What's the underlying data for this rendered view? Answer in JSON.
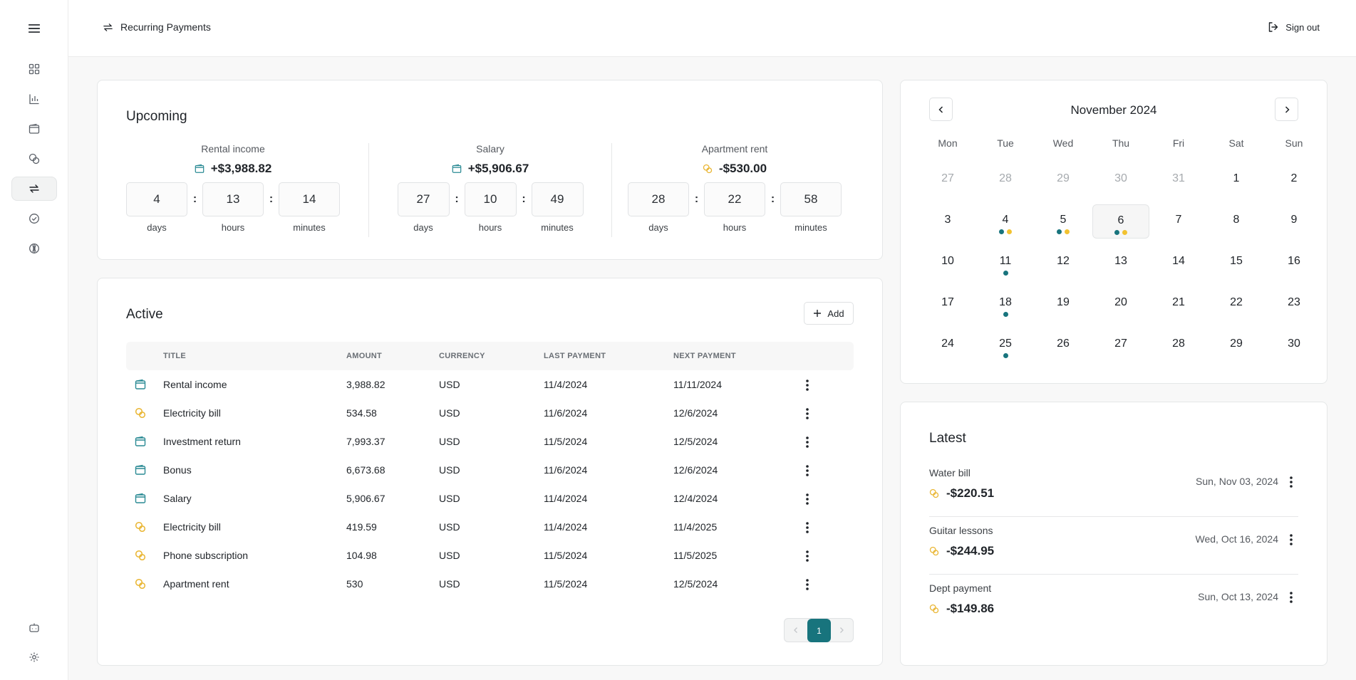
{
  "header": {
    "title": "Recurring Payments",
    "signout_label": "Sign out"
  },
  "sidebar": {
    "items": [
      {
        "icon": "menu-icon"
      },
      {
        "icon": "dashboard-icon"
      },
      {
        "icon": "chart-icon"
      },
      {
        "icon": "wallet-icon"
      },
      {
        "icon": "coins-icon"
      },
      {
        "icon": "recurring-icon",
        "active": true
      },
      {
        "icon": "check-circle-icon"
      },
      {
        "icon": "globe-icon"
      },
      {
        "icon": "bot-icon"
      },
      {
        "icon": "gear-icon"
      }
    ]
  },
  "upcoming": {
    "title": "Upcoming",
    "unit_labels": {
      "days": "days",
      "hours": "hours",
      "minutes": "minutes"
    },
    "items": [
      {
        "label": "Rental income",
        "amount": "+$3,988.82",
        "icon": "wallet-icon",
        "days": "4",
        "hours": "13",
        "minutes": "14"
      },
      {
        "label": "Salary",
        "amount": "+$5,906.67",
        "icon": "wallet-icon",
        "days": "27",
        "hours": "10",
        "minutes": "49"
      },
      {
        "label": "Apartment rent",
        "amount": "-$530.00",
        "icon": "coins-icon",
        "days": "28",
        "hours": "22",
        "minutes": "58"
      }
    ]
  },
  "active": {
    "title": "Active",
    "add_label": "Add",
    "columns": {
      "title": "TITLE",
      "amount": "AMOUNT",
      "currency": "CURRENCY",
      "last_payment": "LAST PAYMENT",
      "next_payment": "NEXT PAYMENT"
    },
    "rows": [
      {
        "icon": "wallet-icon",
        "title": "Rental income",
        "amount": "3,988.82",
        "currency": "USD",
        "last": "11/4/2024",
        "next": "11/11/2024"
      },
      {
        "icon": "coins-icon",
        "title": "Electricity bill",
        "amount": "534.58",
        "currency": "USD",
        "last": "11/6/2024",
        "next": "12/6/2024"
      },
      {
        "icon": "wallet-icon",
        "title": "Investment return",
        "amount": "7,993.37",
        "currency": "USD",
        "last": "11/5/2024",
        "next": "12/5/2024"
      },
      {
        "icon": "wallet-icon",
        "title": "Bonus",
        "amount": "6,673.68",
        "currency": "USD",
        "last": "11/6/2024",
        "next": "12/6/2024"
      },
      {
        "icon": "wallet-icon",
        "title": "Salary",
        "amount": "5,906.67",
        "currency": "USD",
        "last": "11/4/2024",
        "next": "12/4/2024"
      },
      {
        "icon": "coins-icon",
        "title": "Electricity bill",
        "amount": "419.59",
        "currency": "USD",
        "last": "11/4/2024",
        "next": "11/4/2025"
      },
      {
        "icon": "coins-icon",
        "title": "Phone subscription",
        "amount": "104.98",
        "currency": "USD",
        "last": "11/5/2024",
        "next": "11/5/2025"
      },
      {
        "icon": "coins-icon",
        "title": "Apartment rent",
        "amount": "530",
        "currency": "USD",
        "last": "11/5/2024",
        "next": "12/5/2024"
      }
    ],
    "pagination": {
      "current": "1"
    }
  },
  "calendar": {
    "month": "November 2024",
    "weekdays": [
      "Mon",
      "Tue",
      "Wed",
      "Thu",
      "Fri",
      "Sat",
      "Sun"
    ],
    "weeks": [
      [
        {
          "d": "27",
          "muted": true
        },
        {
          "d": "28",
          "muted": true
        },
        {
          "d": "29",
          "muted": true
        },
        {
          "d": "30",
          "muted": true
        },
        {
          "d": "31",
          "muted": true
        },
        {
          "d": "1"
        },
        {
          "d": "2"
        }
      ],
      [
        {
          "d": "3"
        },
        {
          "d": "4",
          "dots": [
            "teal",
            "yellow"
          ]
        },
        {
          "d": "5",
          "dots": [
            "teal",
            "yellow"
          ]
        },
        {
          "d": "6",
          "dots": [
            "teal",
            "yellow"
          ],
          "today": true
        },
        {
          "d": "7"
        },
        {
          "d": "8"
        },
        {
          "d": "9"
        }
      ],
      [
        {
          "d": "10"
        },
        {
          "d": "11",
          "dots": [
            "teal"
          ]
        },
        {
          "d": "12"
        },
        {
          "d": "13"
        },
        {
          "d": "14"
        },
        {
          "d": "15"
        },
        {
          "d": "16"
        }
      ],
      [
        {
          "d": "17"
        },
        {
          "d": "18",
          "dots": [
            "teal"
          ]
        },
        {
          "d": "19"
        },
        {
          "d": "20"
        },
        {
          "d": "21"
        },
        {
          "d": "22"
        },
        {
          "d": "23"
        }
      ],
      [
        {
          "d": "24"
        },
        {
          "d": "25",
          "dots": [
            "teal"
          ]
        },
        {
          "d": "26"
        },
        {
          "d": "27"
        },
        {
          "d": "28"
        },
        {
          "d": "29"
        },
        {
          "d": "30"
        }
      ]
    ]
  },
  "latest": {
    "title": "Latest",
    "items": [
      {
        "title": "Water bill",
        "amount": "-$220.51",
        "date": "Sun, Nov 03, 2024",
        "icon": "coins-icon"
      },
      {
        "title": "Guitar lessons",
        "amount": "-$244.95",
        "date": "Wed, Oct 16, 2024",
        "icon": "coins-icon"
      },
      {
        "title": "Dept payment",
        "amount": "-$149.86",
        "date": "Sun, Oct 13, 2024",
        "icon": "coins-icon"
      }
    ]
  },
  "colors": {
    "accent": "#18747d",
    "income_icon": "#2a8a94",
    "expense_icon": "#e9b531",
    "dot_teal": "#18747d",
    "dot_yellow": "#f2c230"
  }
}
